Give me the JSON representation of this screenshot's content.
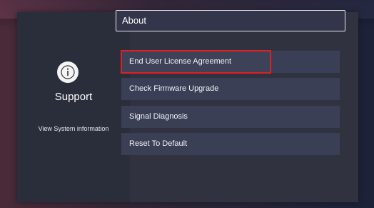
{
  "left": {
    "icon": "info-icon",
    "title": "Support",
    "subtitle": "View System information"
  },
  "header": {
    "title": "About"
  },
  "menu": {
    "items": [
      {
        "label": "End User License Agreement",
        "selected": true
      },
      {
        "label": "Check Firmware Upgrade"
      },
      {
        "label": "Signal Diagnosis"
      },
      {
        "label": "Reset To Default"
      }
    ]
  },
  "colors": {
    "highlight": "#e02020",
    "panel": "#2a2d3a",
    "item": "#3b3f55"
  }
}
